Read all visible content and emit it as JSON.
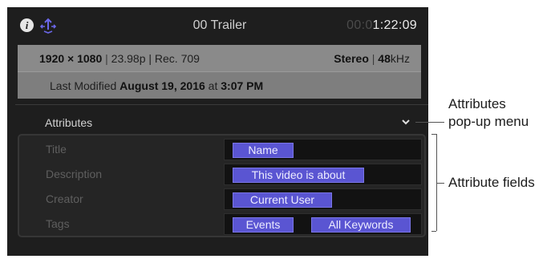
{
  "header": {
    "title": "00 Trailer",
    "timecode_dim": "00:0",
    "timecode_bright": "1:22:09"
  },
  "meta": {
    "resolution": "1920 × 1080",
    "format": "23.98p | Rec. 709",
    "audio_channels": "Stereo",
    "sample_rate_value": "48",
    "sample_rate_unit": "kHz",
    "modified_prefix": "Last Modified",
    "modified_date": "August 19, 2016",
    "modified_at": "at",
    "modified_time": "3:07 PM"
  },
  "attributes": {
    "header": "Attributes",
    "fields": [
      {
        "label": "Title",
        "tokens": [
          "Name"
        ]
      },
      {
        "label": "Description",
        "tokens": [
          "This video is about"
        ]
      },
      {
        "label": "Creator",
        "tokens": [
          "Current User"
        ]
      },
      {
        "label": "Tags",
        "tokens": [
          "Events",
          "All Keywords"
        ]
      }
    ]
  },
  "callouts": {
    "popup_line1": "Attributes",
    "popup_line2": "pop-up menu",
    "fields": "Attribute fields"
  },
  "colors": {
    "panel_bg": "#1e1e1e",
    "token_bg": "#5a55d2",
    "share_icon": "#6b67e8"
  }
}
